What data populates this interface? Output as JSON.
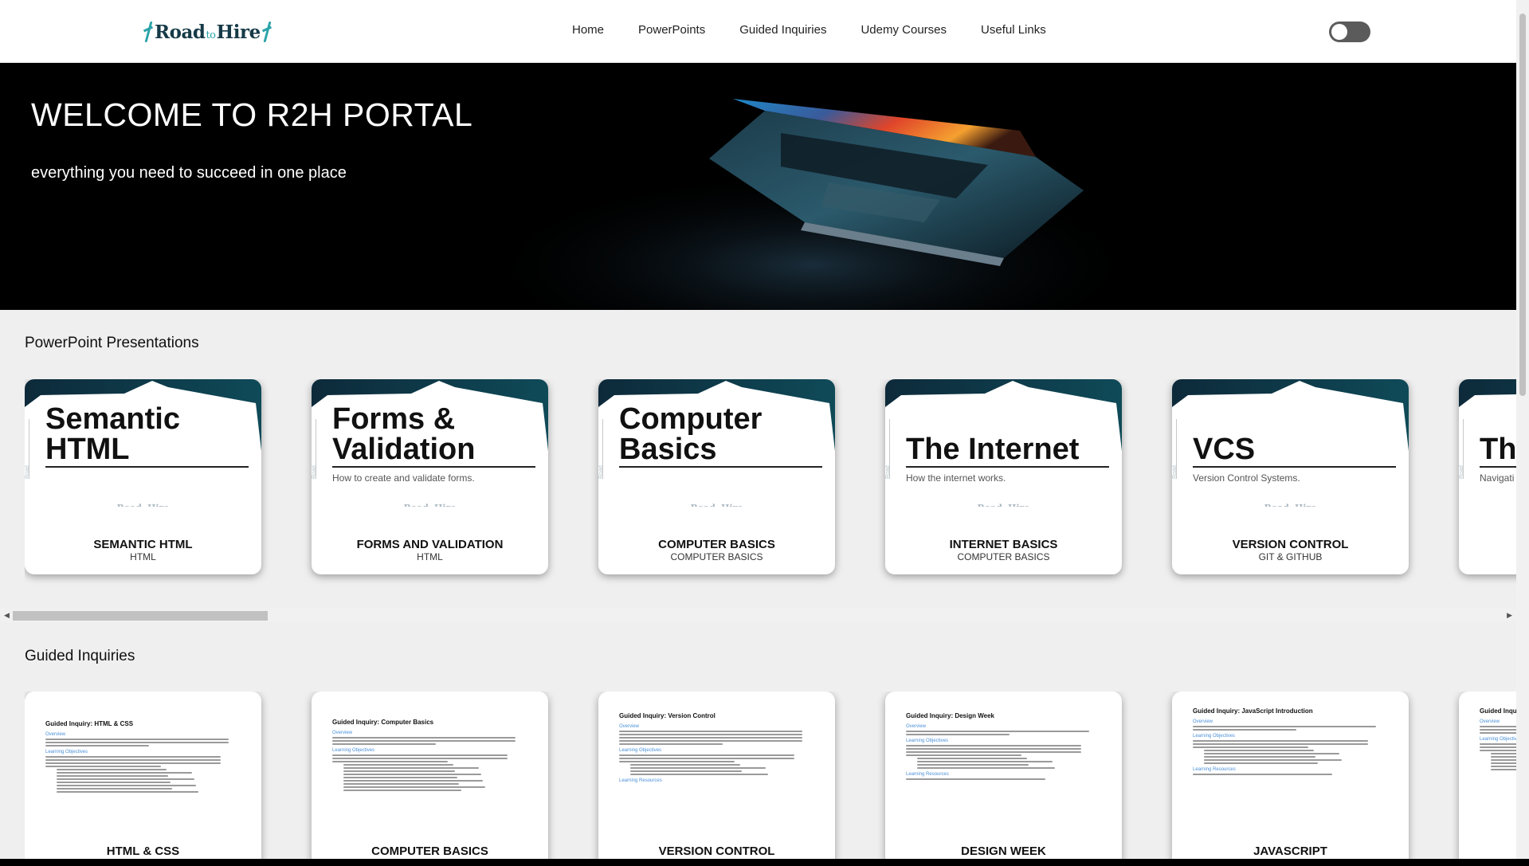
{
  "nav": {
    "logo": {
      "left": "Road",
      "mid": "to",
      "right": "Hire"
    },
    "links": [
      "Home",
      "PowerPoints",
      "Guided Inquiries",
      "Udemy Courses",
      "Useful Links"
    ],
    "theme_toggle": {
      "state": "off"
    }
  },
  "hero": {
    "title": "WELCOME TO R2H PORTAL",
    "subtitle": "everything you need to succeed in one place"
  },
  "powerpoints": {
    "heading": "PowerPoint Presentations",
    "cards": [
      {
        "slide_title": "Semantic HTML",
        "slide_sub": "",
        "title": "SEMANTIC HTML",
        "sub": "HTML"
      },
      {
        "slide_title": "Forms & Validation",
        "slide_sub": "How to create and validate forms.",
        "title": "FORMS AND VALIDATION",
        "sub": "HTML"
      },
      {
        "slide_title": "Computer Basics",
        "slide_sub": "",
        "title": "COMPUTER BASICS",
        "sub": "COMPUTER BASICS"
      },
      {
        "slide_title": "The Internet",
        "slide_sub": "How the internet works.",
        "title": "INTERNET BASICS",
        "sub": "COMPUTER BASICS"
      },
      {
        "slide_title": "VCS",
        "slide_sub": "Version Control Systems.",
        "title": "VERSION CONTROL",
        "sub": "GIT & GITHUB"
      },
      {
        "slide_title": "Th",
        "slide_sub": "Navigati",
        "title": "",
        "sub": ""
      }
    ],
    "slide_logo": {
      "left": "Road",
      "mid": "to",
      "right": "Hire"
    }
  },
  "guided": {
    "heading": "Guided Inquiries",
    "cards": [
      {
        "doc_title": "Guided Inquiry: HTML & CSS",
        "title": "HTML & CSS"
      },
      {
        "doc_title": "Guided Inquiry: Computer Basics",
        "title": "COMPUTER BASICS"
      },
      {
        "doc_title": "Guided Inquiry: Version Control",
        "title": "VERSION CONTROL"
      },
      {
        "doc_title": "Guided Inquiry: Design Week",
        "title": "DESIGN WEEK"
      },
      {
        "doc_title": "Guided Inquiry: JavaScript Introduction",
        "title": "JAVASCRIPT"
      },
      {
        "doc_title": "Guided Inquiry",
        "title": ""
      }
    ],
    "doc_headings": {
      "overview": "Overview",
      "objectives": "Learning Objectives",
      "resources": "Learning Resources"
    }
  },
  "colors": {
    "accent": "#2aa3a8",
    "hero_bg": "#000000",
    "page_bg": "#efefef"
  }
}
